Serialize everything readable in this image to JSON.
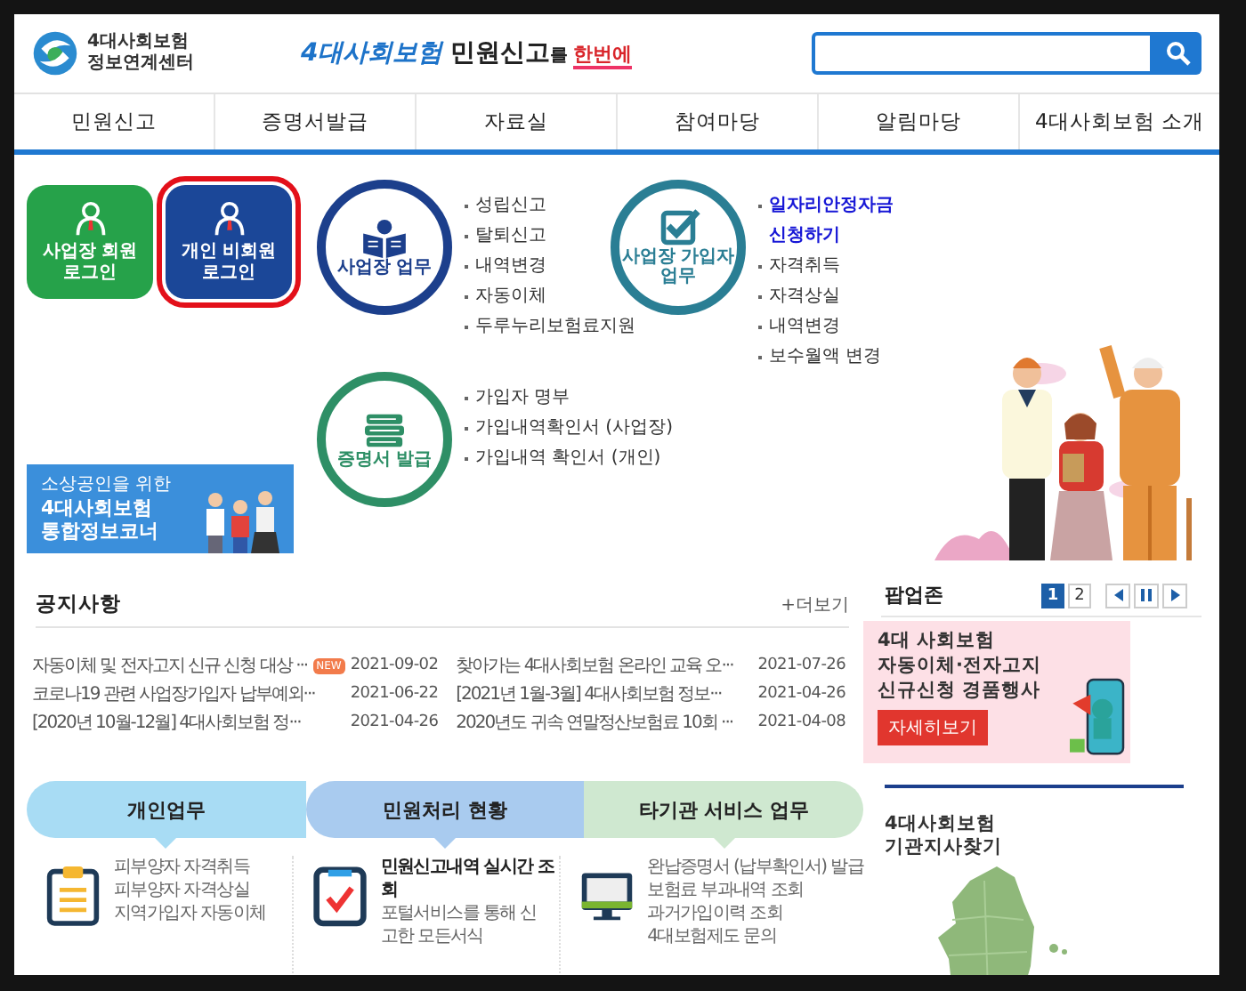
{
  "header": {
    "logo": [
      "4대사회보험",
      "정보연계센터"
    ],
    "slogan": [
      {
        "text": "4대사회보험",
        "kind": "brand"
      },
      {
        "text": "민원신고",
        "kind": "strong"
      },
      {
        "text": "를",
        "kind": "small"
      },
      {
        "text": "한번에",
        "kind": "red"
      }
    ]
  },
  "nav": [
    "민원신고",
    "증명서발급",
    "자료실",
    "참여마당",
    "알림마당",
    "4대사회보험 소개"
  ],
  "login_buttons": [
    {
      "lines": [
        "사업장 회원",
        "로그인"
      ],
      "kind": "business",
      "highlighted": false
    },
    {
      "lines": [
        "개인 비회원",
        "로그인"
      ],
      "kind": "personal",
      "highlighted": true
    }
  ],
  "side_banner": {
    "caption": "소상공인을 위한",
    "title": [
      "4대사회보험",
      "통합정보코너"
    ]
  },
  "services": [
    {
      "lines": [
        "사업장 업무"
      ],
      "kind": "book",
      "items": [
        {
          "text": "성립신고",
          "highlight": false
        },
        {
          "text": "탈퇴신고",
          "highlight": false
        },
        {
          "text": "내역변경",
          "highlight": false
        },
        {
          "text": "자동이체",
          "highlight": false
        },
        {
          "text": "두루누리보험료지원",
          "highlight": false
        }
      ]
    },
    {
      "lines": [
        "사업장 가입자",
        "업무"
      ],
      "kind": "check",
      "items": [
        {
          "text": "일자리안정자금 신청하기",
          "highlight": true
        },
        {
          "text": "자격취득",
          "highlight": false
        },
        {
          "text": "자격상실",
          "highlight": false
        },
        {
          "text": "내역변경",
          "highlight": false
        },
        {
          "text": "보수월액 변경",
          "highlight": false
        }
      ]
    },
    {
      "lines": [
        "증명서 발급"
      ],
      "kind": "stack",
      "items": [
        {
          "text": "가입자 명부",
          "highlight": false
        },
        {
          "text": "가입내역확인서 (사업장)",
          "highlight": false
        },
        {
          "text": "가입내역 확인서 (개인)",
          "highlight": false
        }
      ]
    }
  ],
  "notices": {
    "title": "공지사항",
    "more": "+더보기",
    "items": [
      {
        "title": "자동이체 및 전자고지 신규 신청 대상 ···",
        "badge": "NEW",
        "date": "2021-09-02"
      },
      {
        "title": "찾아가는 4대사회보험 온라인 교육 오···",
        "date": "2021-07-26"
      },
      {
        "title": "코로나19 관련 사업장가입자 납부예외···",
        "date": "2021-06-22"
      },
      {
        "title": "[2021년 1월-3월] 4대사회보험 정보···",
        "date": "2021-04-26"
      },
      {
        "title": "[2020년 10월-12월] 4대사회보험 정···",
        "date": "2021-04-26"
      },
      {
        "title": "2020년도 귀속 연말정산보험료 10회 ···",
        "date": "2021-04-08"
      }
    ]
  },
  "bottom_tabs": [
    {
      "label": "개인업무",
      "color": "#a8dcf4",
      "kind": "clipboard",
      "items": [
        "피부양자 자격취득",
        "피부양자 자격상실",
        "지역가입자 자동이체"
      ]
    },
    {
      "label": "민원처리 현황",
      "color": "#a9cbef",
      "kind": "check",
      "heading": "민원신고내역 실시간 조회",
      "description": "포털서비스를 통해 신고한 모든서식"
    },
    {
      "label": "타기관 서비스 업무",
      "color": "#cfe8d0",
      "kind": "monitor",
      "items": [
        "완납증명서 (납부확인서) 발급",
        "보험료 부과내역 조회",
        "과거가입이력 조회",
        "4대보험제도 문의"
      ]
    }
  ],
  "popup_zone": {
    "title": "팝업존",
    "pages": [
      {
        "label": "1",
        "selected": true
      },
      {
        "label": "2",
        "selected": false
      }
    ],
    "banner": {
      "lines": [
        "4대 사회보험",
        "자동이체·전자고지",
        "신규신청 경품행사"
      ],
      "button": "자세히보기"
    }
  },
  "branch_finder": {
    "title": [
      "4대사회보험",
      "기관지사찾기"
    ]
  }
}
